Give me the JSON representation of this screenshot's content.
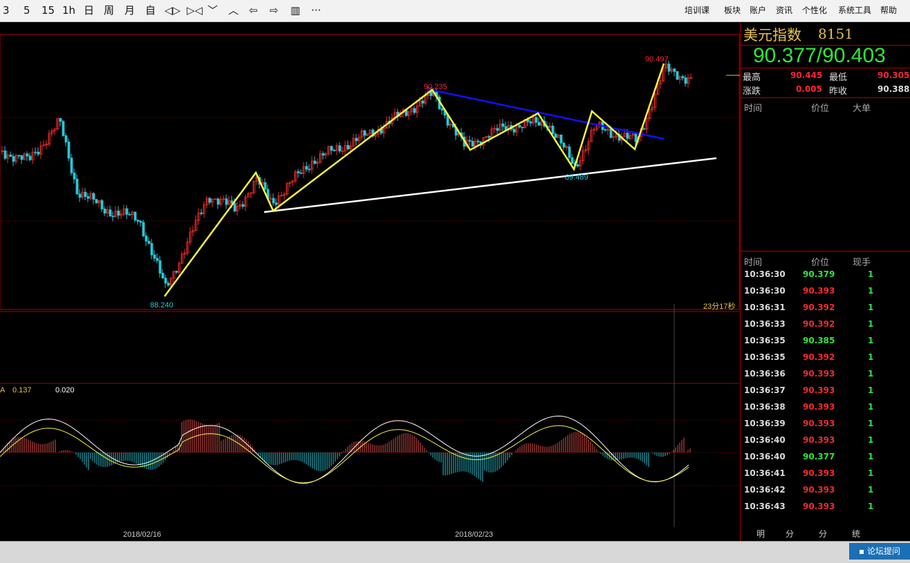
{
  "toolbar": {
    "left_buttons": [
      "3",
      "5",
      "15",
      "1h",
      "日",
      "周",
      "月",
      "自",
      "◁▷",
      "▷◁",
      "﹀",
      "︿",
      "⇦",
      "⇨",
      "▥",
      "···"
    ],
    "menu": [
      "培训课",
      "板块",
      "账户",
      "资讯",
      "个性化",
      "系统工具",
      "帮助"
    ]
  },
  "quote": {
    "name": "美元指数",
    "code": "8151",
    "price": "90.377/90.403",
    "high_label": "最高",
    "high": "90.445",
    "low_label": "最低",
    "low": "90.305",
    "change_label": "涨跌",
    "change": "0.005",
    "prev_close_label": "昨收",
    "prev_close": "90.388"
  },
  "big_orders": {
    "header_time": "时间",
    "header_price": "价位",
    "header_big": "大单"
  },
  "ticks": {
    "header_time": "时间",
    "header_price": "价位",
    "header_vol": "现手",
    "rows": [
      {
        "time": "10:36:30",
        "price": "90.379",
        "vol": "1",
        "dir": "dn"
      },
      {
        "time": "10:36:30",
        "price": "90.393",
        "vol": "1",
        "dir": "up"
      },
      {
        "time": "10:36:31",
        "price": "90.392",
        "vol": "1",
        "dir": "up"
      },
      {
        "time": "10:36:33",
        "price": "90.392",
        "vol": "1",
        "dir": "up"
      },
      {
        "time": "10:36:35",
        "price": "90.385",
        "vol": "1",
        "dir": "dn"
      },
      {
        "time": "10:36:35",
        "price": "90.392",
        "vol": "1",
        "dir": "up"
      },
      {
        "time": "10:36:36",
        "price": "90.393",
        "vol": "1",
        "dir": "up"
      },
      {
        "time": "10:36:37",
        "price": "90.393",
        "vol": "1",
        "dir": "up"
      },
      {
        "time": "10:36:38",
        "price": "90.393",
        "vol": "1",
        "dir": "up"
      },
      {
        "time": "10:36:39",
        "price": "90.393",
        "vol": "1",
        "dir": "up"
      },
      {
        "time": "10:36:40",
        "price": "90.393",
        "vol": "1",
        "dir": "up"
      },
      {
        "time": "10:36:40",
        "price": "90.377",
        "vol": "1",
        "dir": "dn"
      },
      {
        "time": "10:36:41",
        "price": "90.393",
        "vol": "1",
        "dir": "up"
      },
      {
        "time": "10:36:42",
        "price": "90.393",
        "vol": "1",
        "dir": "up"
      },
      {
        "time": "10:36:43",
        "price": "90.393",
        "vol": "1",
        "dir": "up"
      }
    ]
  },
  "panel_tabs": [
    "明细",
    "分价",
    "分笔",
    "统计"
  ],
  "chart": {
    "countdown": "23分17秒",
    "macd_label": "A",
    "macd_val1": "0.137",
    "macd_val2": "0.020",
    "date1": "2018/02/16",
    "date2": "2018/02/23"
  },
  "chart_data": {
    "type": "candlestick",
    "y_range": [
      88.15,
      90.6
    ],
    "annotations": [
      {
        "label": "90.497",
        "value": 90.497
      },
      {
        "label": "90.235",
        "value": 90.235
      },
      {
        "label": "89.489",
        "value": 89.489
      },
      {
        "label": "88.240",
        "value": 88.24
      }
    ],
    "yellow_zigzag": [
      [
        0,
        88.24
      ],
      [
        1,
        89.2
      ],
      [
        2,
        88.9
      ],
      [
        3,
        90.235
      ],
      [
        4,
        89.6
      ],
      [
        5,
        89.95
      ],
      [
        6,
        89.49
      ],
      [
        7,
        90.0
      ],
      [
        8,
        89.75
      ],
      [
        9,
        90.497
      ]
    ]
  },
  "status": {
    "forum_button": "论坛提问"
  },
  "colors": {
    "up": "#f02c2c",
    "down": "#26c9d8",
    "ma": "#f5f542",
    "grid": "#8a0000"
  }
}
